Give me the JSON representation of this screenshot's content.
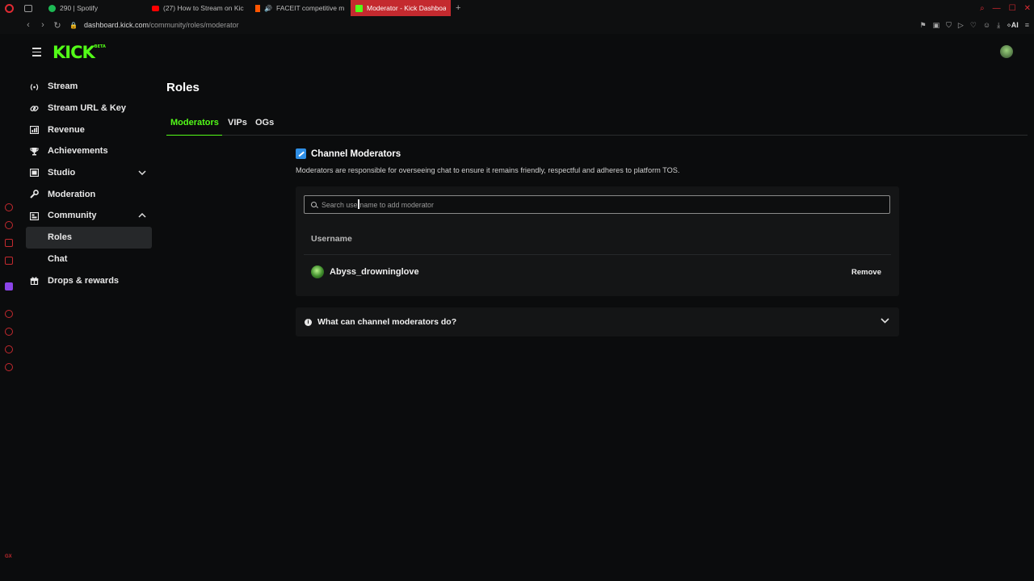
{
  "browser": {
    "tabs": [
      {
        "title": "290 | Spotify",
        "favicon_color": "#1db954",
        "active": false
      },
      {
        "title": "(27) How to Stream on Kic",
        "favicon_color": "#ff0000",
        "active": false
      },
      {
        "title": "FACEIT competitive m",
        "favicon_color": "#ff5500",
        "active": false
      },
      {
        "title": "Moderator - Kick Dashboa",
        "favicon_color": "#53fc18",
        "active": true
      }
    ],
    "new_tab_label": "+",
    "url_host": "dashboard.kick.com",
    "url_path": "/community/roles/moderator",
    "ai_label": "AI"
  },
  "header": {
    "logo": "KICK",
    "logo_badge": "BETA"
  },
  "sidebar": {
    "items": [
      {
        "label": "Stream",
        "icon": "broadcast-icon",
        "glyph": "((•))"
      },
      {
        "label": "Stream URL & Key",
        "icon": "link-icon",
        "glyph": "∞"
      },
      {
        "label": "Revenue",
        "icon": "chart-icon",
        "glyph": "▮"
      },
      {
        "label": "Achievements",
        "icon": "trophy-icon",
        "glyph": "🏆"
      },
      {
        "label": "Studio",
        "icon": "studio-icon",
        "glyph": "▣"
      },
      {
        "label": "Moderation",
        "icon": "wrench-icon",
        "glyph": "🔧"
      },
      {
        "label": "Community",
        "icon": "community-icon",
        "glyph": "▤"
      },
      {
        "label": "Roles",
        "icon": "",
        "glyph": ""
      },
      {
        "label": "Chat",
        "icon": "",
        "glyph": ""
      },
      {
        "label": "Drops & rewards",
        "icon": "gift-icon",
        "glyph": "🎁"
      }
    ]
  },
  "main": {
    "title": "Roles",
    "tabs": [
      {
        "label": "Moderators"
      },
      {
        "label": "VIPs"
      },
      {
        "label": "OGs"
      }
    ],
    "section_title": "Channel Moderators",
    "section_description": "Moderators are responsible for overseeing chat to ensure it remains friendly, respectful and adheres to platform TOS.",
    "search_placeholder": "Search username to add moderator",
    "column_username": "Username",
    "moderators": [
      {
        "username": "Abyss_drowninglove",
        "action": "Remove"
      }
    ],
    "faq_question": "What can channel moderators do?"
  },
  "colors": {
    "accent": "#53fc18",
    "browser_red": "#c42a2f",
    "background": "#0b0c0d",
    "card": "#141516"
  }
}
